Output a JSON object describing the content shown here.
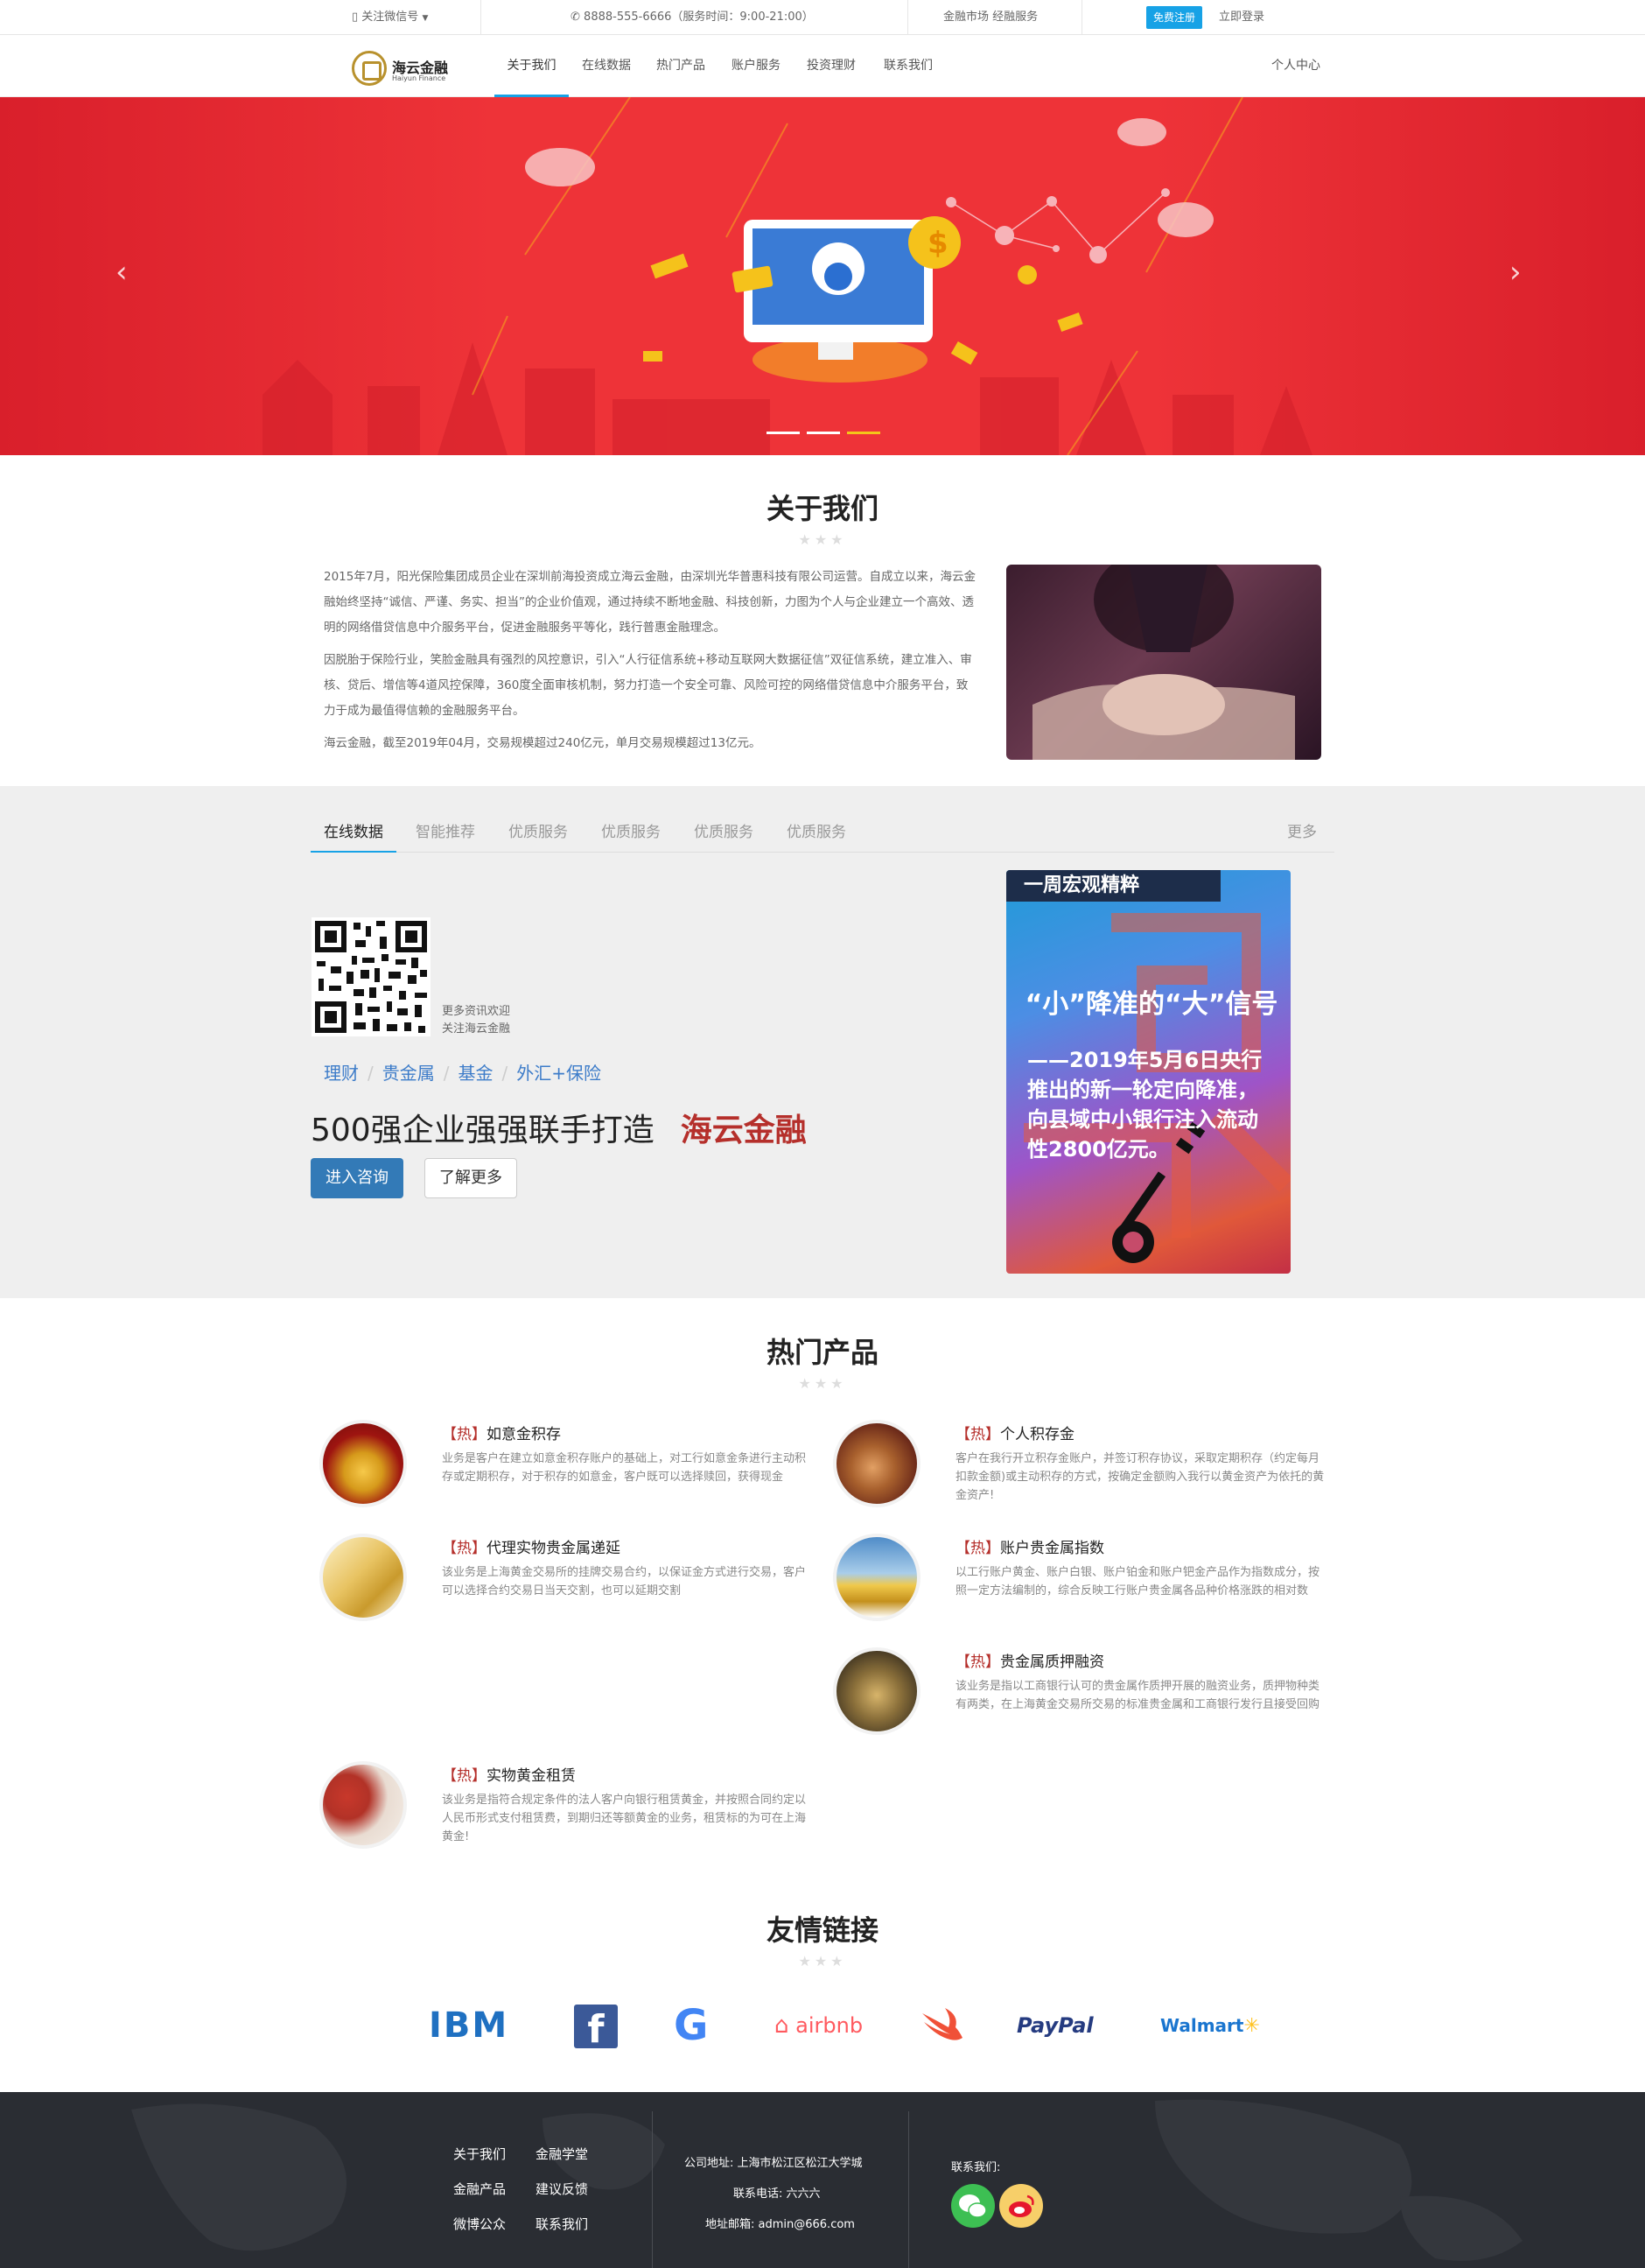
{
  "topbar": {
    "wechat": "关注微信号",
    "phone": "8888-555-6666（服务时间：9:00-21:00）",
    "market": "金融市场 经融服务",
    "register": "免费注册",
    "login": "立即登录"
  },
  "brand": {
    "name": "海云金融",
    "sub": "Haiyun Finance"
  },
  "nav": {
    "items": [
      "关于我们",
      "在线数据",
      "热门产品",
      "账户服务",
      "投资理财",
      "联系我们"
    ],
    "user_center": "个人中心"
  },
  "hero": {
    "prev": "‹",
    "next": "›",
    "slides": 3,
    "active_slide": 3
  },
  "about": {
    "title": "关于我们",
    "stars": "★★★",
    "p1": "2015年7月，阳光保险集团成员企业在深圳前海投资成立海云金融，由深圳光华普惠科技有限公司运营。自成立以来，海云金融始终坚持“诚信、严谨、务实、担当”的企业价值观，通过持续不断地金融、科技创新，力图为个人与企业建立一个高效、透明的网络借贷信息中介服务平台，促进金融服务平等化，践行普惠金融理念。",
    "p2": "因脱胎于保险行业，笑脸金融具有强烈的风控意识，引入“人行征信系统+移动互联网大数据征信”双征信系统，建立准入、审核、贷后、增信等4道风控保障，360度全面审核机制，努力打造一个安全可靠、风险可控的网络借贷信息中介服务平台，致力于成为最值得信赖的金融服务平台。",
    "p3": "海云金融，截至2019年04月，交易规模超过240亿元，单月交易规模超过13亿元。"
  },
  "data_tabs": {
    "tabs": [
      "在线数据",
      "智能推荐",
      "优质服务",
      "优质服务",
      "优质服务",
      "优质服务"
    ],
    "more": "更多"
  },
  "online": {
    "qr_line1": "更多资讯欢迎",
    "qr_line2": "关注海云金融",
    "tags": [
      "理财",
      "贵金属",
      "基金",
      "外汇+保险"
    ],
    "slogan": "500强企业强强联手打造",
    "slogan_brand": "海云金融",
    "btn_consult": "进入咨询",
    "btn_more": "了解更多"
  },
  "poster": {
    "header": "一周宏观精粹",
    "quote": "“小”降准的“大”信号",
    "detail": "——2019年5月6日央行推出的新一轮定向降准，向县域中小银行注入流动性2800亿元。"
  },
  "products": {
    "title": "热门产品",
    "stars": "★★★",
    "hot": "【热】",
    "items": [
      {
        "name": "如意金积存",
        "desc": "业务是客户在建立如意金积存账户的基础上，对工行如意金条进行主动积存或定期积存，对于积存的如意金，客户既可以选择赎回，获得现金"
      },
      {
        "name": "个人积存金",
        "desc": "客户在我行开立积存金账户，并签订积存协议，采取定期积存（约定每月扣款金额)或主动积存的方式，按确定金额购入我行以黄金资产为依托的黄金资产!"
      },
      {
        "name": "代理实物贵金属递延",
        "desc": "该业务是上海黄金交易所的挂牌交易合约，以保证金方式进行交易，客户可以选择合约交易日当天交割，也可以延期交割"
      },
      {
        "name": "账户贵金属指数",
        "desc": "以工行账户黄金、账户白银、账户铂金和账户钯金产品作为指数成分，按照一定方法编制的，综合反映工行账户贵金属各品种价格涨跌的相对数"
      },
      {
        "name": "贵金属质押融资",
        "desc": "该业务是指以工商银行认可的贵金属作质押开展的融资业务，质押物种类有两类，在上海黄金交易所交易的标准贵金属和工商银行发行且接受回购"
      },
      {
        "name": "实物黄金租赁",
        "desc": "该业务是指符合规定条件的法人客户向银行租赁黄金，并按照合同约定以人民币形式支付租赁费，到期归还等额黄金的业务，租赁标的为可在上海黄金!"
      }
    ]
  },
  "friends": {
    "title": "友情链接",
    "stars": "★★★",
    "logos": [
      "IBM",
      "f",
      "G",
      "airbnb",
      "swift",
      "PayPal",
      "Walmart"
    ]
  },
  "footer": {
    "links": [
      "关于我们",
      "金融学堂",
      "金融产品",
      "建议反馈",
      "微博公众",
      "联系我们"
    ],
    "address": "公司地址: 上海市松江区松江大学城",
    "phone": "联系电话: 六六六",
    "email": "地址邮箱: admin@666.com",
    "contact": "联系我们:"
  },
  "colors": {
    "accent": "#17a2e6",
    "brand_red": "#b52f2b",
    "hero_red": "#ee3338",
    "footer_bg": "#2a2d33"
  }
}
